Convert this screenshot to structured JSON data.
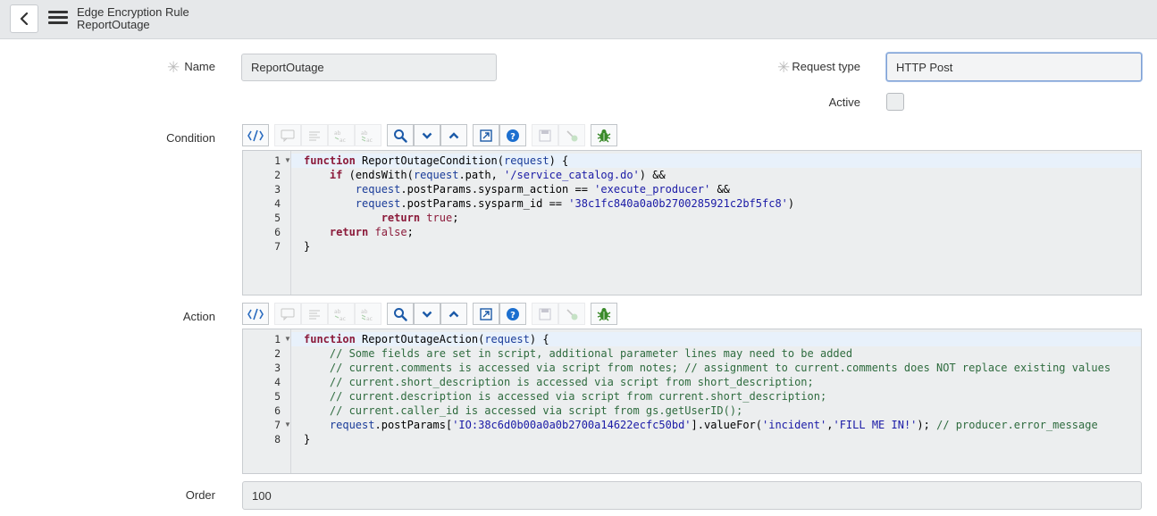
{
  "header": {
    "title": "Edge Encryption Rule",
    "subtitle": "ReportOutage"
  },
  "form": {
    "name_label": "Name",
    "name_value": "ReportOutage",
    "request_type_label": "Request type",
    "request_type_value": "HTTP Post",
    "active_label": "Active",
    "active_checked": false,
    "condition_label": "Condition",
    "action_label": "Action",
    "order_label": "Order",
    "order_value": "100"
  },
  "toolbar_icons": [
    "format-code-icon",
    "comment-icon",
    "align-icon",
    "replace-icon",
    "replace-all-icon",
    "search-icon",
    "chevron-down-icon",
    "chevron-up-icon",
    "fullscreen-icon",
    "help-icon",
    "save-icon",
    "script-debug-icon",
    "bug-icon"
  ],
  "condition_code": [
    "function ReportOutageCondition(request) {",
    "    if (endsWith(request.path, '/service_catalog.do') &&",
    "        request.postParams.sysparm_action == 'execute_producer' &&",
    "        request.postParams.sysparm_id == '38c1fc840a0a0b2700285921c2bf5fc8')",
    "            return true;",
    "    return false;",
    "}"
  ],
  "action_code": [
    "function ReportOutageAction(request) {",
    "    // Some fields are set in script, additional parameter lines may need to be added",
    "    // current.comments is accessed via script from notes; // assignment to current.comments does NOT replace existing values",
    "    // current.short_description is accessed via script from short_description;",
    "    // current.description is accessed via script from current.short_description;",
    "    // current.caller_id is accessed via script from gs.getUserID();",
    "    request.postParams['IO:38c6d0b00a0a0b2700a14622ecfc50bd'].valueFor('incident','FILL ME IN!'); // producer.error_message",
    "}"
  ],
  "colors": {
    "header_bg": "#e6e8ea",
    "field_bg": "#eceeef",
    "keyword": "#8b1a3a",
    "string": "#1a1aa6",
    "comment": "#2e6b3e",
    "focus_border": "#7ea0d4"
  }
}
